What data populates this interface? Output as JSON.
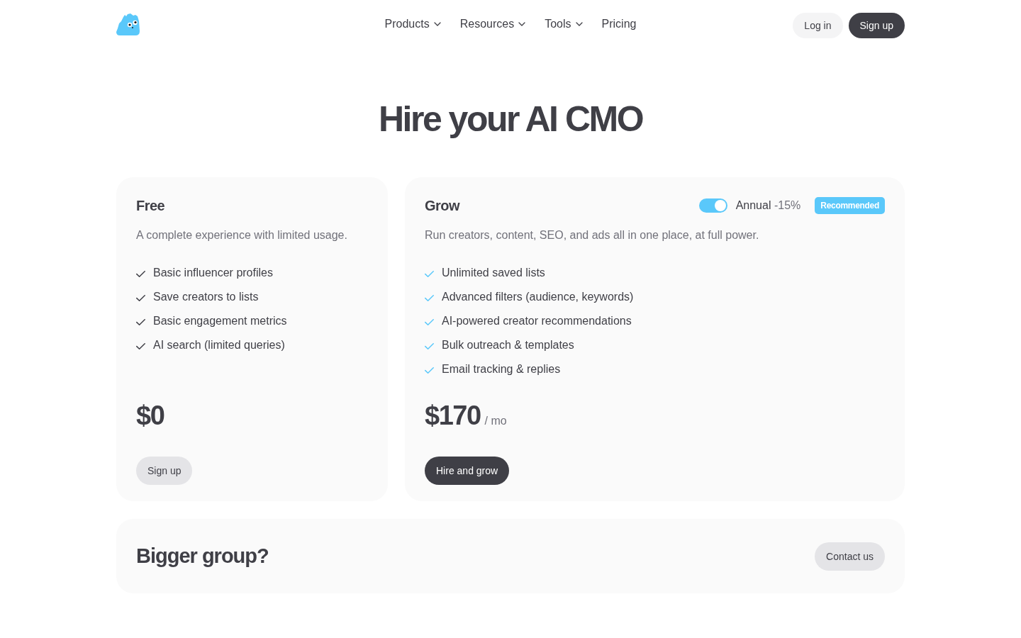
{
  "nav": {
    "links": [
      {
        "label": "Products",
        "dropdown": true
      },
      {
        "label": "Resources",
        "dropdown": true
      },
      {
        "label": "Tools",
        "dropdown": true
      },
      {
        "label": "Pricing",
        "dropdown": false
      }
    ],
    "buttons": [
      {
        "label": "Log in",
        "kind": "secondary"
      },
      {
        "label": "Sign up",
        "kind": "primary"
      }
    ]
  },
  "hero": {
    "title": "Hire your AI CMO"
  },
  "plans": [
    {
      "name": "Free",
      "featured": false,
      "description": "A complete experience with limited usage.",
      "features": [
        "Basic influencer profiles",
        "Save creators to lists",
        "Basic engagement metrics",
        "AI search (limited queries)"
      ],
      "price": "$0",
      "button": {
        "label": "Sign up",
        "kind": "secondary"
      }
    },
    {
      "name": "Grow",
      "featured": true,
      "billing_toggle": {
        "label": "Annual",
        "discount": "-15%",
        "on": true
      },
      "badge": "Recommended",
      "description": "Run creators, content, SEO, and ads all in one place, at full power.",
      "features": [
        "Unlimited saved lists",
        "Advanced filters (audience, keywords)",
        "AI-powered creator recommendations",
        "Bulk outreach & templates",
        "Email tracking & replies"
      ],
      "price": "$170",
      "period": "/ mo",
      "button": {
        "label": "Hire and grow",
        "kind": "primary"
      }
    }
  ],
  "contact": {
    "title": "Bigger group?",
    "button": "Contact us"
  }
}
